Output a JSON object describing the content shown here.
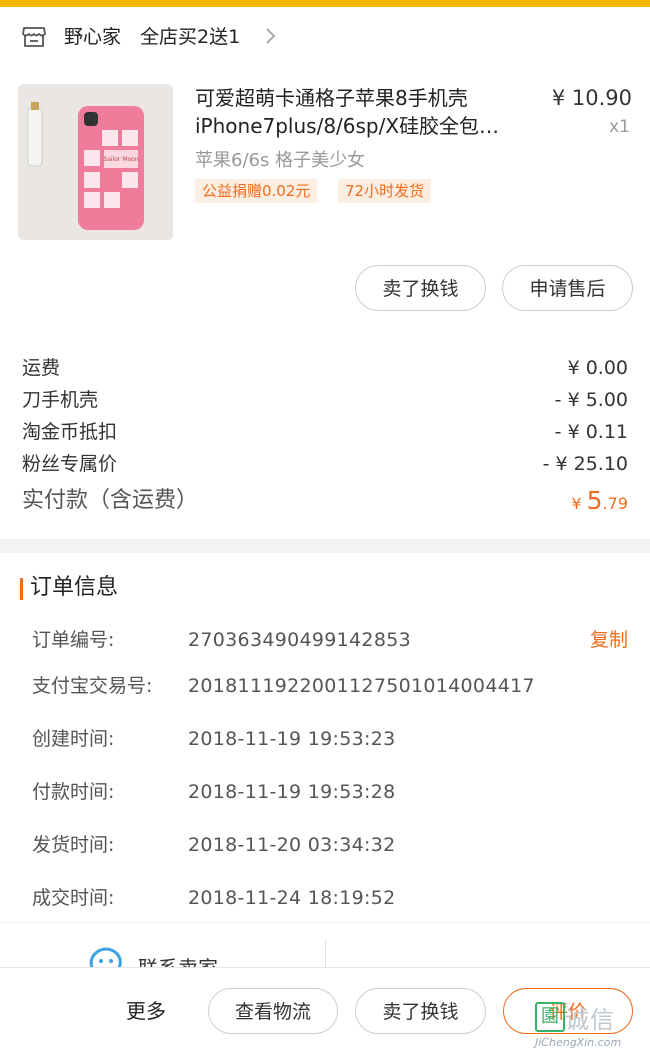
{
  "shop": {
    "name": "野心家",
    "promo": "全店买2送1"
  },
  "product": {
    "title_line1": "可爱超萌卡通格子苹果8手机壳",
    "title_line2": "iPhone7plus/8/6sp/X硅胶全包…",
    "price": "¥ 10.90",
    "qty": "x1",
    "sku": "苹果6/6s  格子美少女",
    "tags": [
      "公益捐赠0.02元",
      "72小时发货"
    ],
    "image_label": "Sailor Moon"
  },
  "item_actions": {
    "sell": "卖了换钱",
    "after_sale": "申请售后"
  },
  "fees": [
    {
      "label": "运费",
      "value": "¥ 0.00"
    },
    {
      "label": "刀手机壳",
      "value": "- ¥ 5.00"
    },
    {
      "label": "淘金币抵扣",
      "value": "- ¥ 0.11"
    },
    {
      "label": "粉丝专属价",
      "value": "- ¥ 25.10"
    }
  ],
  "total": {
    "label": "实付款（含运费）",
    "currency": "¥ ",
    "integer": "5",
    "decimal": ".79"
  },
  "order_info": {
    "title": "订单信息",
    "copy_label": "复制",
    "rows": [
      {
        "key": "订单编号:",
        "value": "270363490499142853"
      },
      {
        "key": "支付宝交易号:",
        "value": "2018111922001127501014004417"
      },
      {
        "key": "创建时间:",
        "value": "2018-11-19 19:53:23"
      },
      {
        "key": "付款时间:",
        "value": "2018-11-19 19:53:28"
      },
      {
        "key": "发货时间:",
        "value": "2018-11-20 03:34:32"
      },
      {
        "key": "成交时间:",
        "value": "2018-11-24 18:19:52"
      }
    ]
  },
  "contact": {
    "seller": "联系卖家"
  },
  "bottom": {
    "more": "更多",
    "logistics": "查看物流",
    "sell": "卖了换钱",
    "review": "评价"
  },
  "watermark": {
    "text": "诚信",
    "box": "園",
    "url": "JiChengXin.com"
  },
  "colors": {
    "accent": "#f26b1d",
    "top_bar": "#f4b800"
  }
}
